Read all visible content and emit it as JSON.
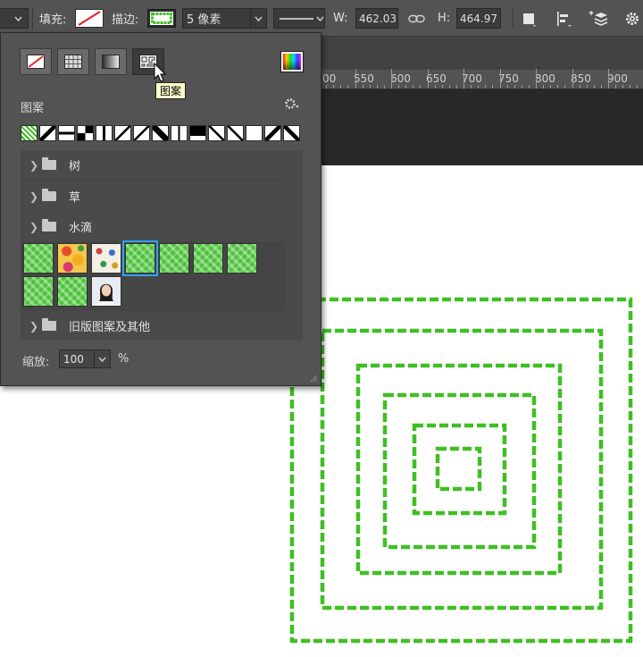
{
  "options_bar": {
    "fill_label": "填充:",
    "stroke_label": "描边:",
    "stroke_width": "5 像素",
    "w_label": "W:",
    "w_value": "462.03",
    "h_label": "H:",
    "h_value": "464.97"
  },
  "ruler": {
    "labels": [
      "00",
      "550",
      "600",
      "650",
      "700",
      "750",
      "800",
      "850",
      "900"
    ]
  },
  "panel": {
    "type_buttons": [
      "no-fill",
      "solid-color",
      "gradient",
      "pattern"
    ],
    "tooltip": "图案",
    "section_label": "图案",
    "folders": [
      "树",
      "草",
      "水滴"
    ],
    "folder_legacy": "旧版图案及其他",
    "scale_label": "缩放:",
    "scale_value": "100",
    "scale_unit": "%"
  },
  "colors": {
    "stroke_green": "#3fbf23",
    "panel_bg": "#535353",
    "selection_blue": "#2ea3f2"
  }
}
